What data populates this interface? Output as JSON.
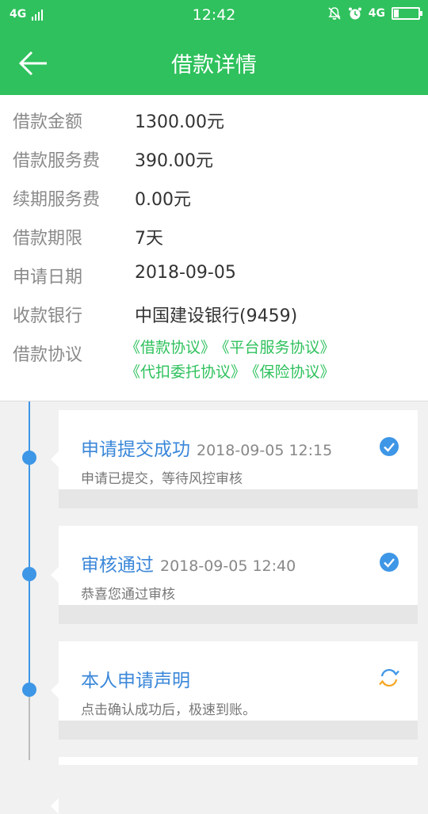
{
  "status_bar": {
    "left_signal": "4G",
    "time": "12:42",
    "right_signal": "4G"
  },
  "header": {
    "title": "借款详情"
  },
  "details": {
    "rows": [
      {
        "label": "借款金额",
        "value": "1300.00元"
      },
      {
        "label": "借款服务费",
        "value": "390.00元"
      },
      {
        "label": "续期服务费",
        "value": "0.00元"
      },
      {
        "label": "借款期限",
        "value": "7天"
      },
      {
        "label": "申请日期",
        "value": "2018-09-05"
      },
      {
        "label": "收款银行",
        "value": "中国建设银行(9459)"
      }
    ],
    "agreement_label": "借款协议",
    "agreements": [
      "《借款协议》",
      "《平台服务协议》",
      "《代扣委托协议》",
      "《保险协议》"
    ]
  },
  "timeline": [
    {
      "title": "申请提交成功",
      "time": "2018-09-05 12:15",
      "desc": "申请已提交，等待风控审核",
      "status_icon": "check-circle-icon"
    },
    {
      "title": "审核通过",
      "time": "2018-09-05 12:40",
      "desc": "恭喜您通过审核",
      "status_icon": "check-circle-icon"
    },
    {
      "title": "本人申请声明",
      "time": "",
      "desc": "点击确认成功后，极速到账。",
      "status_icon": "refresh-icon"
    }
  ],
  "colors": {
    "brand_green": "#2fc15d",
    "timeline_blue": "#3e96e6",
    "refresh_orange": "#f5a623"
  }
}
